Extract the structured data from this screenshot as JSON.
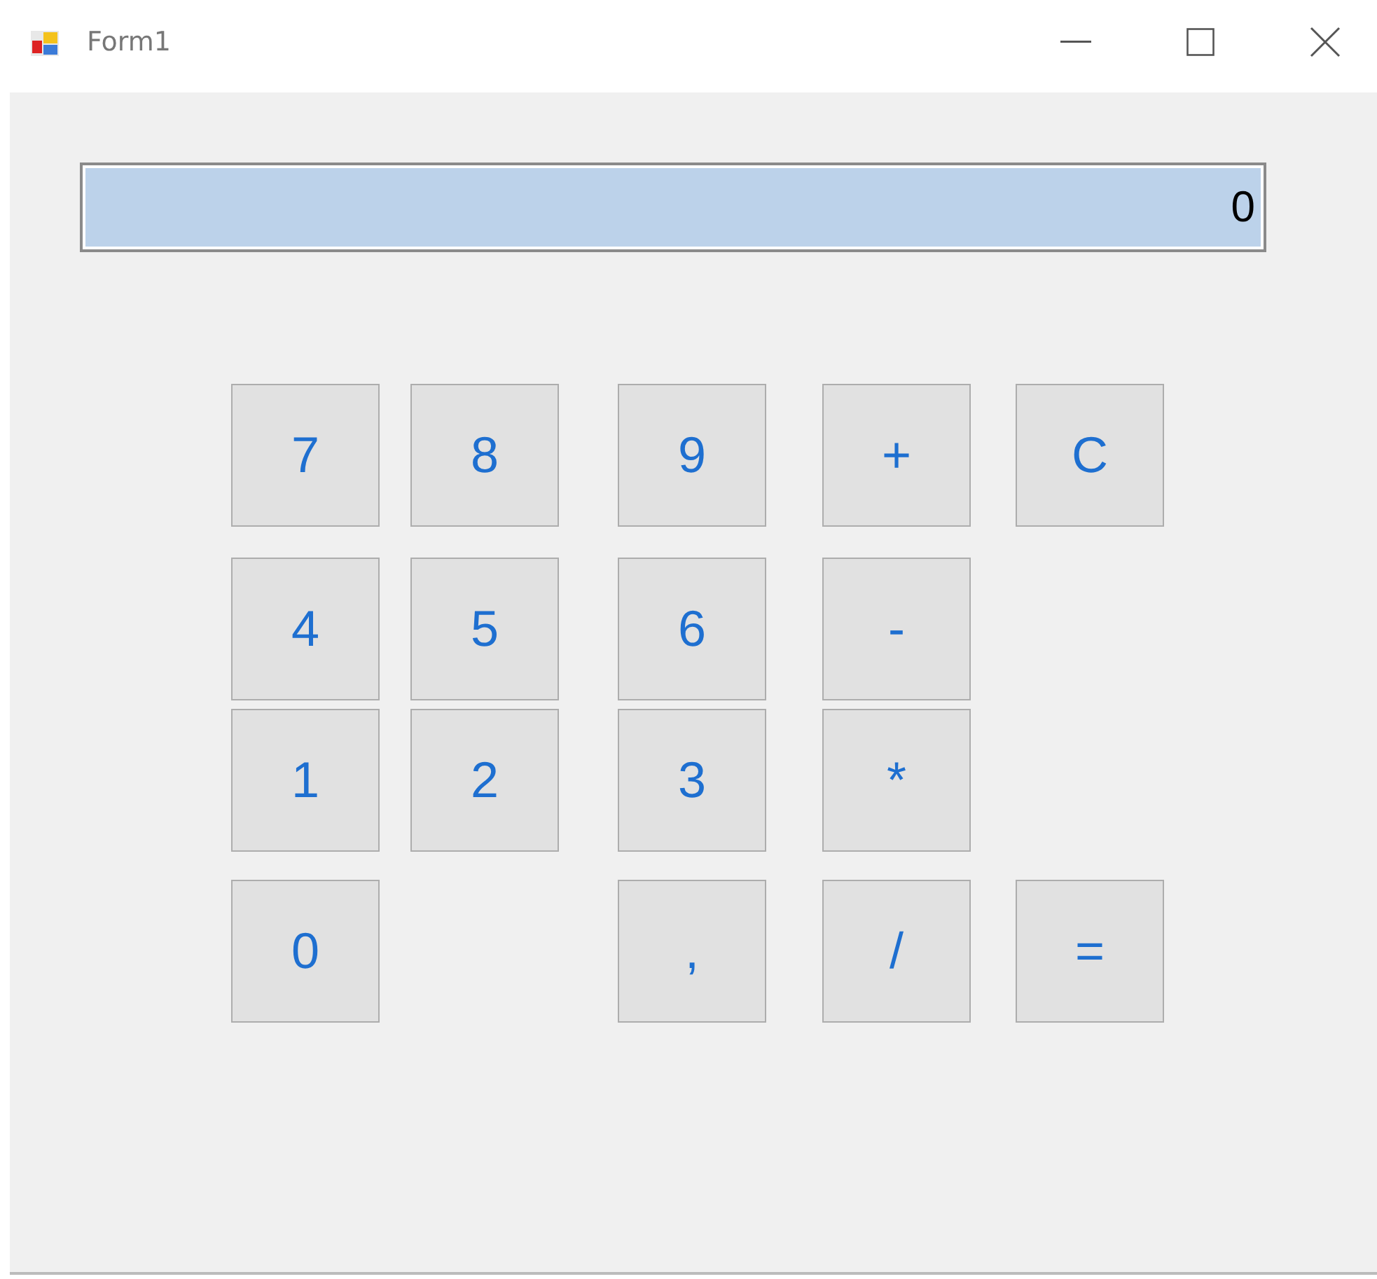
{
  "window": {
    "title": "Form1"
  },
  "display": {
    "value": "0"
  },
  "buttons": [
    {
      "label": "7"
    },
    {
      "label": "8"
    },
    {
      "label": "9"
    },
    {
      "label": "+"
    },
    {
      "label": "C"
    },
    {
      "label": "4"
    },
    {
      "label": "5"
    },
    {
      "label": "6"
    },
    {
      "label": "-"
    },
    {
      "label": "1"
    },
    {
      "label": "2"
    },
    {
      "label": "3"
    },
    {
      "label": "*"
    },
    {
      "label": "0"
    },
    {
      "label": ","
    },
    {
      "label": "/"
    },
    {
      "label": "="
    }
  ]
}
